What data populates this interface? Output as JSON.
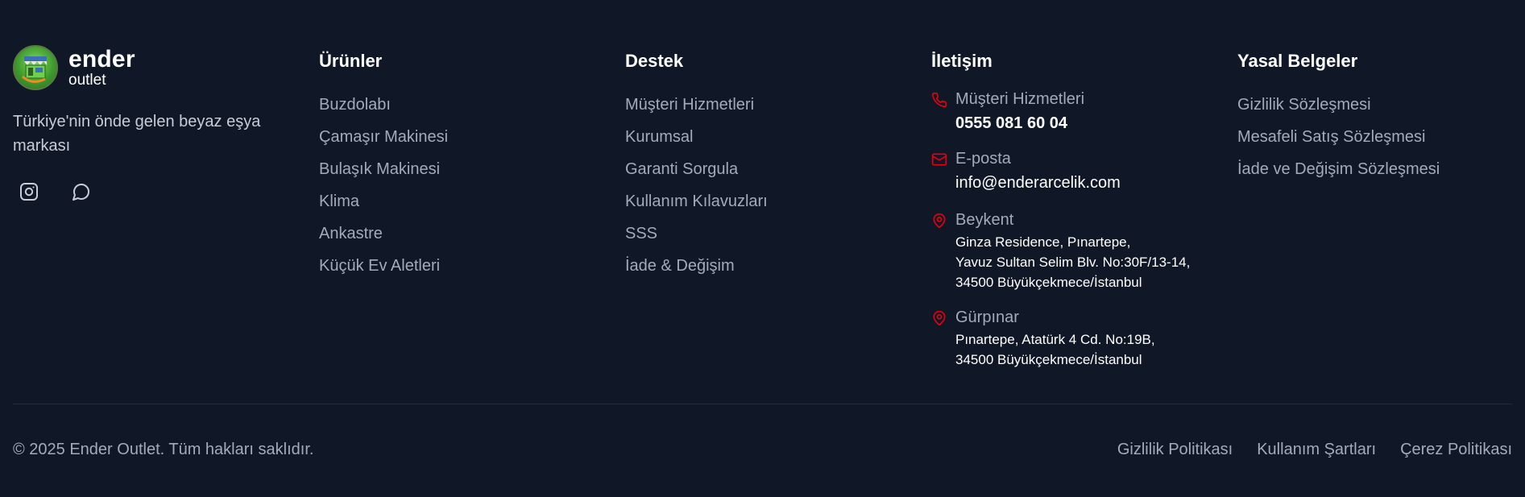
{
  "brand": {
    "name": "ender",
    "sub": "outlet",
    "tagline": "Türkiye'nin önde gelen beyaz eşya markası",
    "socials": [
      {
        "icon": "instagram-icon"
      },
      {
        "icon": "chat-bubble-icon"
      }
    ]
  },
  "products": {
    "title": "Ürünler",
    "items": [
      "Buzdolabı",
      "Çamaşır Makinesi",
      "Bulaşık Makinesi",
      "Klima",
      "Ankastre",
      "Küçük Ev Aletleri"
    ]
  },
  "support": {
    "title": "Destek",
    "items": [
      "Müşteri Hizmetleri",
      "Kurumsal",
      "Garanti Sorgula",
      "Kullanım Kılavuzları",
      "SSS",
      "İade & Değişim"
    ]
  },
  "contact": {
    "title": "İletişim",
    "phone": {
      "label": "Müşteri Hizmetleri",
      "value": "0555 081 60 04",
      "icon": "phone-icon"
    },
    "email": {
      "label": "E-posta",
      "value": "info@enderarcelik.com",
      "icon": "mail-icon"
    },
    "beykent": {
      "label": "Beykent",
      "icon": "map-pin-icon",
      "lines": [
        "Ginza Residence, Pınartepe,",
        "Yavuz Sultan Selim Blv. No:30F/13-14,",
        "34500 Büyükçekmece/İstanbul"
      ]
    },
    "gurpinar": {
      "label": "Gürpınar",
      "icon": "map-pin-icon",
      "lines": [
        "Pınartepe, Atatürk 4 Cd. No:19B,",
        "34500 Büyükçekmece/İstanbul"
      ]
    }
  },
  "legal": {
    "title": "Yasal Belgeler",
    "items": [
      "Gizlilik Sözleşmesi",
      "Mesafeli Satış Sözleşmesi",
      "İade ve Değişim Sözleşmesi"
    ]
  },
  "bottom": {
    "copyright": "© 2025 Ender Outlet. Tüm hakları saklıdır.",
    "links": [
      "Gizlilik Politikası",
      "Kullanım Şartları",
      "Çerez Politikası"
    ]
  },
  "colors": {
    "background": "#101828",
    "accent": "#e7000b",
    "muted_text": "#a3abb8",
    "divider": "#1f2a3b"
  }
}
